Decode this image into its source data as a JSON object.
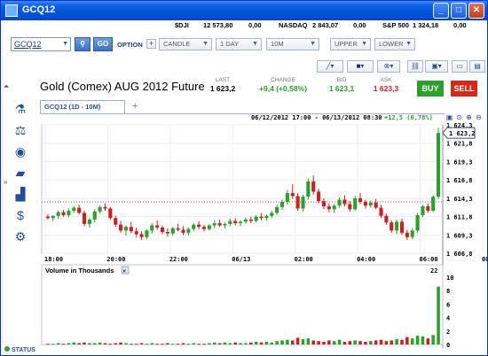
{
  "window": {
    "title": "GCQ12"
  },
  "tickers": [
    {
      "symbol": "$DJI",
      "value": "12 573,80",
      "change": "0,00"
    },
    {
      "symbol": "NASDAQ",
      "value": "2 843,07",
      "change": "0,00"
    },
    {
      "symbol": "S&P 500",
      "value": "1 324,18",
      "change": "0,00"
    }
  ],
  "toolbar": {
    "symbol_value": "GCQ12",
    "go_label": "GO",
    "option_label": "OPTION",
    "chart_type": "CANDLE",
    "period": "1 DAY",
    "interval": "10M",
    "upper": "UPPER",
    "lower": "LOWER"
  },
  "quote": {
    "title": "Gold (Comex) AUG 2012 Future",
    "last_label": "LAST",
    "last_value": "1 623,2",
    "change_label": "CHANGE",
    "change_value": "+9,4 (+0,58%)",
    "bid_label": "BID",
    "bid_value": "1 623,1",
    "ask_label": "ASK",
    "ask_value": "1 623,3",
    "buy_label": "BUY",
    "sell_label": "SELL"
  },
  "tab": {
    "label": "GCQ12 (1D - 10M)",
    "add": "+"
  },
  "chart_header": {
    "range": "06/12/2012 17:00 - 06/13/2012 08:30",
    "change": "+12,5 (0,78%)"
  },
  "volume_title": "Volume in Thousands",
  "volume_max_label": "22",
  "status_label": "STATUS",
  "colors": {
    "up": "#2ca02c",
    "down": "#cc2020",
    "accent": "#2a4f8e",
    "reference_line": "#d04040"
  },
  "chart_data": {
    "type": "candlestick",
    "price_axis": [
      "1 624,3",
      "1 621,8",
      "1 619,3",
      "1 616,8",
      "1 614,3",
      "1 611,8",
      "1 609,3",
      "1 606,8"
    ],
    "price_ylim": [
      1606.8,
      1624.3
    ],
    "current_price_label": "1 623,2",
    "time_axis": [
      "18:00",
      "20:00",
      "22:00",
      "06/13",
      "02:00",
      "04:00",
      "06:00",
      "08:00"
    ],
    "volume_axis": [
      "8",
      "6",
      "4",
      "2",
      "0"
    ],
    "volume_ylim": [
      0,
      10
    ],
    "reference_price": 1613.8,
    "candles": [
      [
        1611.8,
        1612.1,
        1611.4,
        1611.6
      ],
      [
        1611.6,
        1612.0,
        1611.2,
        1611.9
      ],
      [
        1611.9,
        1612.6,
        1611.5,
        1612.4
      ],
      [
        1612.4,
        1612.7,
        1611.8,
        1612.0
      ],
      [
        1612.0,
        1612.9,
        1611.7,
        1612.6
      ],
      [
        1612.6,
        1613.2,
        1612.3,
        1613.0
      ],
      [
        1613.0,
        1613.4,
        1612.1,
        1612.3
      ],
      [
        1612.3,
        1612.6,
        1610.5,
        1610.8
      ],
      [
        1610.8,
        1611.6,
        1610.3,
        1611.4
      ],
      [
        1611.4,
        1612.8,
        1611.0,
        1612.5
      ],
      [
        1612.5,
        1613.3,
        1612.2,
        1613.1
      ],
      [
        1613.1,
        1613.6,
        1612.6,
        1612.9
      ],
      [
        1612.9,
        1613.1,
        1611.4,
        1611.6
      ],
      [
        1611.6,
        1611.9,
        1610.4,
        1610.7
      ],
      [
        1610.7,
        1611.2,
        1609.6,
        1609.9
      ],
      [
        1609.9,
        1610.6,
        1609.2,
        1610.4
      ],
      [
        1610.4,
        1611.1,
        1609.5,
        1609.8
      ],
      [
        1609.8,
        1610.3,
        1609.0,
        1609.4
      ],
      [
        1609.4,
        1609.8,
        1608.6,
        1609.0
      ],
      [
        1609.0,
        1610.1,
        1608.7,
        1609.9
      ],
      [
        1609.9,
        1610.9,
        1609.5,
        1610.6
      ],
      [
        1610.6,
        1611.3,
        1610.0,
        1610.3
      ],
      [
        1610.3,
        1610.6,
        1609.4,
        1609.7
      ],
      [
        1609.7,
        1610.2,
        1609.1,
        1609.5
      ],
      [
        1609.5,
        1610.4,
        1609.2,
        1610.2
      ],
      [
        1610.2,
        1610.8,
        1609.8,
        1610.0
      ],
      [
        1610.0,
        1610.5,
        1609.3,
        1609.6
      ],
      [
        1609.6,
        1610.3,
        1609.2,
        1610.1
      ],
      [
        1610.1,
        1610.9,
        1609.8,
        1610.7
      ],
      [
        1610.7,
        1611.2,
        1610.1,
        1610.4
      ],
      [
        1610.4,
        1610.7,
        1609.8,
        1610.1
      ],
      [
        1610.1,
        1610.8,
        1609.9,
        1610.6
      ],
      [
        1610.6,
        1611.3,
        1610.2,
        1610.9
      ],
      [
        1610.9,
        1611.4,
        1610.4,
        1610.6
      ],
      [
        1610.6,
        1611.0,
        1610.2,
        1610.8
      ],
      [
        1610.8,
        1611.5,
        1610.5,
        1611.2
      ],
      [
        1611.2,
        1611.6,
        1610.6,
        1610.9
      ],
      [
        1610.9,
        1611.3,
        1610.5,
        1611.1
      ],
      [
        1611.1,
        1611.7,
        1610.8,
        1611.4
      ],
      [
        1611.4,
        1611.8,
        1610.9,
        1611.2
      ],
      [
        1611.2,
        1612.0,
        1611.0,
        1611.8
      ],
      [
        1611.8,
        1612.3,
        1611.3,
        1611.6
      ],
      [
        1611.6,
        1612.1,
        1611.2,
        1611.9
      ],
      [
        1611.9,
        1612.6,
        1611.6,
        1612.3
      ],
      [
        1612.3,
        1613.4,
        1612.0,
        1613.1
      ],
      [
        1613.1,
        1614.1,
        1612.7,
        1613.8
      ],
      [
        1613.8,
        1615.4,
        1613.4,
        1615.0
      ],
      [
        1615.0,
        1616.2,
        1614.2,
        1614.6
      ],
      [
        1614.6,
        1615.0,
        1612.6,
        1612.9
      ],
      [
        1612.9,
        1614.8,
        1612.5,
        1614.5
      ],
      [
        1614.5,
        1617.0,
        1614.1,
        1616.6
      ],
      [
        1616.6,
        1617.4,
        1614.8,
        1615.2
      ],
      [
        1615.2,
        1615.6,
        1613.6,
        1613.9
      ],
      [
        1613.9,
        1614.3,
        1612.8,
        1613.2
      ],
      [
        1613.2,
        1613.6,
        1612.4,
        1612.8
      ],
      [
        1612.8,
        1613.5,
        1612.3,
        1613.3
      ],
      [
        1613.3,
        1614.4,
        1613.0,
        1614.1
      ],
      [
        1614.1,
        1614.7,
        1613.2,
        1613.5
      ],
      [
        1613.5,
        1613.9,
        1612.5,
        1612.8
      ],
      [
        1612.8,
        1614.6,
        1612.6,
        1614.3
      ],
      [
        1614.3,
        1615.0,
        1613.5,
        1613.8
      ],
      [
        1613.8,
        1614.1,
        1612.9,
        1613.3
      ],
      [
        1613.3,
        1614.0,
        1613.0,
        1613.7
      ],
      [
        1613.7,
        1614.2,
        1612.8,
        1613.0
      ],
      [
        1613.0,
        1613.4,
        1611.6,
        1611.9
      ],
      [
        1611.9,
        1612.2,
        1610.7,
        1611.0
      ],
      [
        1611.0,
        1611.3,
        1609.6,
        1609.9
      ],
      [
        1609.9,
        1611.4,
        1609.4,
        1611.1
      ],
      [
        1611.1,
        1611.5,
        1609.3,
        1609.6
      ],
      [
        1609.6,
        1610.0,
        1608.6,
        1609.0
      ],
      [
        1609.0,
        1610.2,
        1608.7,
        1609.9
      ],
      [
        1609.9,
        1612.3,
        1609.6,
        1612.0
      ],
      [
        1612.0,
        1613.4,
        1611.7,
        1613.2
      ],
      [
        1613.2,
        1613.6,
        1612.3,
        1612.6
      ],
      [
        1612.6,
        1614.7,
        1612.4,
        1614.5
      ],
      [
        1614.5,
        1623.9,
        1614.2,
        1623.2
      ]
    ],
    "volumes": [
      0.1,
      0.1,
      0.2,
      0.1,
      0.2,
      0.3,
      0.2,
      0.3,
      0.2,
      0.2,
      0.3,
      0.2,
      0.1,
      0.2,
      0.3,
      0.2,
      0.1,
      0.1,
      0.2,
      0.1,
      0.2,
      0.1,
      0.1,
      0.2,
      0.1,
      0.1,
      0.2,
      0.1,
      0.2,
      0.1,
      0.1,
      0.2,
      0.3,
      0.2,
      0.3,
      0.2,
      0.3,
      0.2,
      0.2,
      0.3,
      0.4,
      0.3,
      0.4,
      0.3,
      0.5,
      0.6,
      0.7,
      0.6,
      1.0,
      0.8,
      0.9,
      0.6,
      0.5,
      0.4,
      0.6,
      0.5,
      0.7,
      0.4,
      0.5,
      0.6,
      0.5,
      0.4,
      0.5,
      0.6,
      0.7,
      0.5,
      0.6,
      0.8,
      0.7,
      1.1,
      0.9,
      1.3,
      1.2,
      0.9,
      1.4,
      8.6
    ]
  }
}
